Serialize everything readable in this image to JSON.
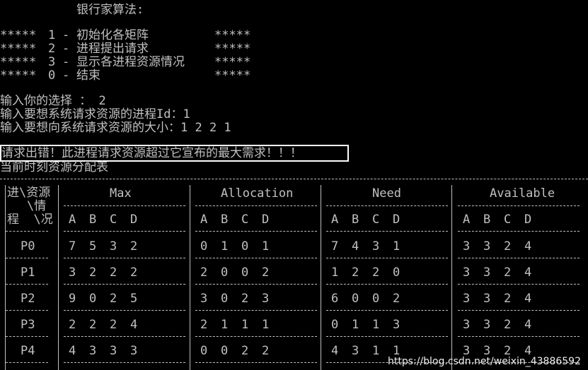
{
  "title": "银行家算法:",
  "menu": [
    {
      "left": "*****",
      "num": "1",
      "label": "初始化各矩阵",
      "right": "*****"
    },
    {
      "left": "*****",
      "num": "2",
      "label": "进程提出请求",
      "right": "*****"
    },
    {
      "left": "*****",
      "num": "3",
      "label": "显示各进程资源情况",
      "right": "*****"
    },
    {
      "left": "*****",
      "num": "0",
      "label": "结束",
      "right": "*****"
    }
  ],
  "prompts": [
    "输入你的选择 ： 2",
    "输入要想系统请求资源的进程Id：1",
    "输入要想向系统请求资源的大小：1 2 2 1"
  ],
  "error": "请求出错！此进程请求资源超过它宣布的最大需求！！！",
  "table_caption": "当前时刻资源分配表",
  "corner": [
    "进\\资源",
    "\\情",
    "程  \\况"
  ],
  "groups": [
    "Max",
    "Allocation",
    "Need",
    "Available"
  ],
  "resources": [
    "A",
    "B",
    "C",
    "D"
  ],
  "rows": [
    {
      "p": "P0",
      "max": [
        "7",
        "5",
        "3",
        "2"
      ],
      "alloc": [
        "0",
        "1",
        "0",
        "1"
      ],
      "need": [
        "7",
        "4",
        "3",
        "1"
      ],
      "avail": [
        "3",
        "3",
        "2",
        "4"
      ]
    },
    {
      "p": "P1",
      "max": [
        "3",
        "2",
        "2",
        "2"
      ],
      "alloc": [
        "2",
        "0",
        "0",
        "2"
      ],
      "need": [
        "1",
        "2",
        "2",
        "0"
      ],
      "avail": [
        "3",
        "3",
        "2",
        "4"
      ]
    },
    {
      "p": "P2",
      "max": [
        "9",
        "0",
        "2",
        "5"
      ],
      "alloc": [
        "3",
        "0",
        "2",
        "3"
      ],
      "need": [
        "6",
        "0",
        "0",
        "2"
      ],
      "avail": [
        "3",
        "3",
        "2",
        "4"
      ]
    },
    {
      "p": "P3",
      "max": [
        "2",
        "2",
        "2",
        "4"
      ],
      "alloc": [
        "2",
        "1",
        "1",
        "1"
      ],
      "need": [
        "0",
        "1",
        "1",
        "3"
      ],
      "avail": [
        "3",
        "3",
        "2",
        "4"
      ]
    },
    {
      "p": "P4",
      "max": [
        "4",
        "3",
        "3",
        "3"
      ],
      "alloc": [
        "0",
        "0",
        "2",
        "2"
      ],
      "need": [
        "4",
        "3",
        "1",
        "1"
      ],
      "avail": [
        "3",
        "3",
        "2",
        "4"
      ]
    }
  ],
  "watermark": "https://blog.csdn.net/weixin_43886592"
}
